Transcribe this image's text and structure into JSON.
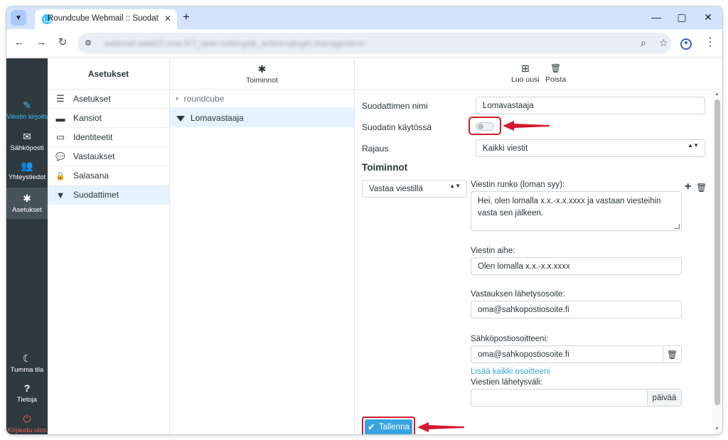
{
  "browser": {
    "tab_title": "Roundcube Webmail :: Suodatti",
    "tab_menu_icon": "chevron-down-icon",
    "close_tab_glyph": "✕",
    "new_tab_glyph": "+",
    "minimize_glyph": "—",
    "maximize_glyph": "▢",
    "close_window_glyph": "✕",
    "back_glyph": "←",
    "forward_glyph": "→",
    "reload_glyph": "↻",
    "url": "webmail.web02.oma.fi/?_task=settings&_action=plugin.managesieve",
    "zoom_glyph": "⌕",
    "star_glyph": "☆",
    "menu_glyph": "⋮"
  },
  "rail": {
    "items": [
      {
        "label": "Viestin kirjoittaminen",
        "icon": "compose-icon",
        "glyph": "✎"
      },
      {
        "label": "Sähköposti",
        "icon": "envelope-icon",
        "glyph": "✉"
      },
      {
        "label": "Yhteystiedot",
        "icon": "contacts-icon",
        "glyph": "👥"
      },
      {
        "label": "Asetukset",
        "icon": "gear-icon",
        "glyph": "✱"
      }
    ],
    "bottom": [
      {
        "label": "Tumma tila",
        "icon": "moon-icon",
        "glyph": "☾"
      },
      {
        "label": "Tietoja",
        "icon": "question-icon",
        "glyph": "?"
      },
      {
        "label": "Kirjaudu ulos",
        "icon": "power-icon",
        "glyph": "⏻"
      }
    ]
  },
  "sidebar": {
    "title": "Asetukset",
    "items": [
      {
        "label": "Asetukset",
        "icon": "sliders-icon",
        "glyph": "☰"
      },
      {
        "label": "Kansiot",
        "icon": "folder-icon",
        "glyph": "▬"
      },
      {
        "label": "Identiteetit",
        "icon": "id-card-icon",
        "glyph": "▭"
      },
      {
        "label": "Vastaukset",
        "icon": "comment-icon",
        "glyph": "💬"
      },
      {
        "label": "Salasana",
        "icon": "lock-icon",
        "glyph": "🔒"
      },
      {
        "label": "Suodattimet",
        "icon": "filter-icon",
        "glyph": "▼"
      }
    ]
  },
  "filters": {
    "actions_label": "Toiminnot",
    "actions_glyph": "✱",
    "set_chevron": "›",
    "set_name": "roundcube",
    "selected_filter": "Lomavastaaja"
  },
  "content": {
    "create_label": "Luo uusi",
    "create_glyph": "⊞",
    "delete_label": "Poista",
    "delete_glyph": "🗑",
    "filter_name_label": "Suodattimen nimi",
    "filter_name_value": "Lomavastaaja",
    "enabled_label": "Suodatin käytössä",
    "enabled": false,
    "scope_label": "Rajaus",
    "scope_value": "Kaikki viestit",
    "select_arrows": "▲▼",
    "actions_title": "Toiminnot",
    "action_type_value": "Vastaa viestillä",
    "add_glyph": "+",
    "remove_glyph": "🗑",
    "body_label": "Viestin runko (loman syy):",
    "body_value": "Hei, olen lomalla x.x.-x.x.xxxx ja vastaan viesteihin vasta sen jälkeen.",
    "subject_label": "Viestin aihe:",
    "subject_value": "Olen lomalla x.x.-x.x.xxxx",
    "reply_sender_label": "Vastauksen lähetysosoite:",
    "reply_sender_value": "oma@sahkopostiosoite.fi",
    "addresses_label": "Sähköpostiosoitteeni:",
    "addresses_value": "oma@sahkopostiosoite.fi",
    "address_trash_glyph": "🗑",
    "add_all_link": "Lisää kaikki osoitteeni",
    "interval_label": "Viestien lähetysväli:",
    "interval_value": "",
    "interval_unit": "päivää",
    "save_glyph": "✔",
    "save_label": "Tallenna"
  },
  "colors": {
    "accent": "#37beff",
    "highlight": "#d21a2e",
    "rail_bg": "#2f3a3f",
    "selection_bg": "#e6f2ff"
  }
}
